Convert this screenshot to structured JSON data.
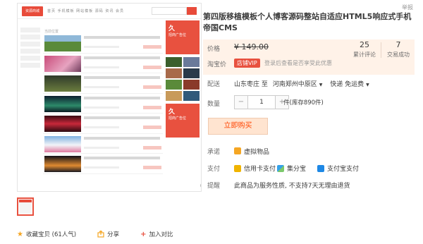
{
  "report_label": "举报",
  "preview": {
    "logo_text": "资源商城",
    "nav_text": "首页 手机模板 网站模板 源码 资讯 会员",
    "crumb_text": "当前位置",
    "ad_big": "久",
    "ad_small": "招商广告位"
  },
  "product": {
    "title": "第四版移植模板个人博客源码整站自适应HTML5响应式手机帝国CMS"
  },
  "price": {
    "label": "价格",
    "value": "¥ 149.00",
    "reviews_count": "25",
    "reviews_label": "累计评论",
    "sales_count": "7",
    "sales_label": "交易成功",
    "taobao_label": "淘宝价",
    "vip_badge": "店铺VIP",
    "vip_note": "登录后查看是否享受此优惠"
  },
  "delivery": {
    "label": "配送",
    "from": "山东枣庄 至",
    "to": "河南郑州中原区",
    "method": "快递 免运费"
  },
  "quantity": {
    "label": "数量",
    "minus": "−",
    "value": "1",
    "plus": "+",
    "stock": "件(库存890件)"
  },
  "buy_button": "立即购买",
  "promise": {
    "label": "承诺",
    "value": "虚拟物品"
  },
  "payment": {
    "label": "支付",
    "methods": [
      "信用卡支付",
      "集分宝",
      "支付宝支付"
    ]
  },
  "tip": {
    "label": "提醒",
    "value": "此商品为服务性质, 不支持7天无理由退货"
  },
  "actions": {
    "favorite": "收藏宝贝 (61人气)",
    "share": "分享",
    "compare": "加入对比"
  },
  "colors": {
    "accent": "#e8513f",
    "price_bg": "#fff2e8",
    "buy_text": "#ff4400"
  }
}
